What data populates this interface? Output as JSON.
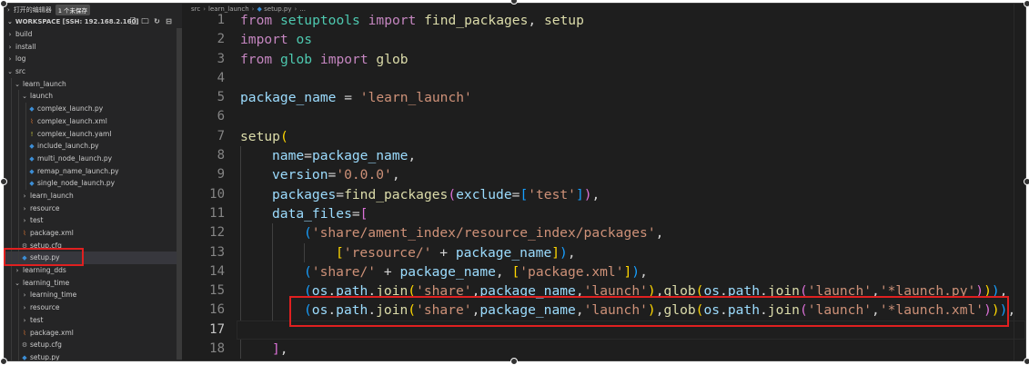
{
  "open_editors": {
    "title": "打开的编辑器",
    "badge": "1 个未保存"
  },
  "workspace": {
    "title": "WORKSPACE [SSH: 192.168.2.160]"
  },
  "tree": [
    {
      "label": "build",
      "type": "folder",
      "depth": 0,
      "open": false
    },
    {
      "label": "install",
      "type": "folder",
      "depth": 0,
      "open": false
    },
    {
      "label": "log",
      "type": "folder",
      "depth": 0,
      "open": false
    },
    {
      "label": "src",
      "type": "folder",
      "depth": 0,
      "open": true
    },
    {
      "label": "learn_launch",
      "type": "folder",
      "depth": 1,
      "open": true
    },
    {
      "label": "launch",
      "type": "folder",
      "depth": 2,
      "open": true
    },
    {
      "label": "complex_launch.py",
      "type": "py",
      "depth": 3
    },
    {
      "label": "complex_launch.xml",
      "type": "xml",
      "depth": 3
    },
    {
      "label": "complex_launch.yaml",
      "type": "yaml",
      "depth": 3
    },
    {
      "label": "include_launch.py",
      "type": "py",
      "depth": 3
    },
    {
      "label": "multi_node_launch.py",
      "type": "py",
      "depth": 3
    },
    {
      "label": "remap_name_launch.py",
      "type": "py",
      "depth": 3
    },
    {
      "label": "single_node_launch.py",
      "type": "py",
      "depth": 3
    },
    {
      "label": "learn_launch",
      "type": "folder",
      "depth": 2,
      "open": false
    },
    {
      "label": "resource",
      "type": "folder",
      "depth": 2,
      "open": false
    },
    {
      "label": "test",
      "type": "folder",
      "depth": 2,
      "open": false
    },
    {
      "label": "package.xml",
      "type": "xml",
      "depth": 2
    },
    {
      "label": "setup.cfg",
      "type": "cfg",
      "depth": 2
    },
    {
      "label": "setup.py",
      "type": "py",
      "depth": 2,
      "selected": true
    },
    {
      "label": "learning_dds",
      "type": "folder",
      "depth": 1,
      "open": false
    },
    {
      "label": "learning_time",
      "type": "folder",
      "depth": 1,
      "open": true
    },
    {
      "label": "learning_time",
      "type": "folder",
      "depth": 2,
      "open": false
    },
    {
      "label": "resource",
      "type": "folder",
      "depth": 2,
      "open": false
    },
    {
      "label": "test",
      "type": "folder",
      "depth": 2,
      "open": false
    },
    {
      "label": "package.xml",
      "type": "xml",
      "depth": 2
    },
    {
      "label": "setup.cfg",
      "type": "cfg",
      "depth": 2
    },
    {
      "label": "setup.py",
      "type": "py",
      "depth": 2
    }
  ],
  "breadcrumb": [
    "src",
    "learn_launch",
    "setup.py",
    "..."
  ],
  "code": [
    {
      "n": "1",
      "indent": 0,
      "tokens": [
        [
          "kw",
          "from"
        ],
        [
          "pl",
          " "
        ],
        [
          "mod",
          "setuptools"
        ],
        [
          "pl",
          " "
        ],
        [
          "kw",
          "import"
        ],
        [
          "pl",
          " "
        ],
        [
          "fn",
          "find_packages"
        ],
        [
          "pl",
          ", "
        ],
        [
          "fn",
          "setup"
        ]
      ]
    },
    {
      "n": "2",
      "indent": 0,
      "tokens": [
        [
          "kw",
          "import"
        ],
        [
          "pl",
          " "
        ],
        [
          "mod",
          "os"
        ]
      ]
    },
    {
      "n": "3",
      "indent": 0,
      "tokens": [
        [
          "kw",
          "from"
        ],
        [
          "pl",
          " "
        ],
        [
          "mod",
          "glob"
        ],
        [
          "pl",
          " "
        ],
        [
          "kw",
          "import"
        ],
        [
          "pl",
          " "
        ],
        [
          "fn",
          "glob"
        ]
      ]
    },
    {
      "n": "4",
      "indent": 0,
      "tokens": []
    },
    {
      "n": "5",
      "indent": 0,
      "tokens": [
        [
          "var",
          "package_name"
        ],
        [
          "pl",
          " = "
        ],
        [
          "str",
          "'learn_launch'"
        ]
      ]
    },
    {
      "n": "6",
      "indent": 0,
      "tokens": []
    },
    {
      "n": "7",
      "indent": 0,
      "tokens": [
        [
          "fn",
          "setup"
        ],
        [
          "b1",
          "("
        ]
      ]
    },
    {
      "n": "8",
      "indent": 1,
      "tokens": [
        [
          "var",
          "name"
        ],
        [
          "pl",
          "="
        ],
        [
          "var",
          "package_name"
        ],
        [
          "pl",
          ","
        ]
      ]
    },
    {
      "n": "9",
      "indent": 1,
      "tokens": [
        [
          "var",
          "version"
        ],
        [
          "pl",
          "="
        ],
        [
          "str",
          "'0.0.0'"
        ],
        [
          "pl",
          ","
        ]
      ]
    },
    {
      "n": "10",
      "indent": 1,
      "tokens": [
        [
          "var",
          "packages"
        ],
        [
          "pl",
          "="
        ],
        [
          "fn",
          "find_packages"
        ],
        [
          "b2",
          "("
        ],
        [
          "var",
          "exclude"
        ],
        [
          "pl",
          "="
        ],
        [
          "b3",
          "["
        ],
        [
          "str",
          "'test'"
        ],
        [
          "b3",
          "]"
        ],
        [
          "b2",
          ")"
        ],
        [
          "pl",
          ","
        ]
      ]
    },
    {
      "n": "11",
      "indent": 1,
      "tokens": [
        [
          "var",
          "data_files"
        ],
        [
          "pl",
          "="
        ],
        [
          "b2",
          "["
        ]
      ]
    },
    {
      "n": "12",
      "indent": 2,
      "tokens": [
        [
          "b3",
          "("
        ],
        [
          "str",
          "'share/ament_index/resource_index/packages'"
        ],
        [
          "pl",
          ","
        ]
      ]
    },
    {
      "n": "13",
      "indent": 3,
      "tokens": [
        [
          "b1",
          "["
        ],
        [
          "str",
          "'resource/'"
        ],
        [
          "pl",
          " + "
        ],
        [
          "var",
          "package_name"
        ],
        [
          "b1",
          "]"
        ],
        [
          "b3",
          ")"
        ],
        [
          "pl",
          ","
        ]
      ]
    },
    {
      "n": "14",
      "indent": 2,
      "tokens": [
        [
          "b3",
          "("
        ],
        [
          "str",
          "'share/'"
        ],
        [
          "pl",
          " + "
        ],
        [
          "var",
          "package_name"
        ],
        [
          "pl",
          ", "
        ],
        [
          "b1",
          "["
        ],
        [
          "str",
          "'package.xml'"
        ],
        [
          "b1",
          "]"
        ],
        [
          "b3",
          ")"
        ],
        [
          "pl",
          ","
        ]
      ]
    },
    {
      "n": "15",
      "indent": 2,
      "tokens": [
        [
          "b3",
          "("
        ],
        [
          "var",
          "os"
        ],
        [
          "pl",
          "."
        ],
        [
          "var",
          "path"
        ],
        [
          "pl",
          "."
        ],
        [
          "fn",
          "join"
        ],
        [
          "b1",
          "("
        ],
        [
          "str",
          "'share'"
        ],
        [
          "pl",
          ","
        ],
        [
          "var",
          "package_name"
        ],
        [
          "pl",
          ","
        ],
        [
          "str",
          "'launch'"
        ],
        [
          "b1",
          ")"
        ],
        [
          "pl",
          ","
        ],
        [
          "fn",
          "glob"
        ],
        [
          "b1",
          "("
        ],
        [
          "var",
          "os"
        ],
        [
          "pl",
          "."
        ],
        [
          "var",
          "path"
        ],
        [
          "pl",
          "."
        ],
        [
          "fn",
          "join"
        ],
        [
          "b2",
          "("
        ],
        [
          "str",
          "'launch'"
        ],
        [
          "pl",
          ","
        ],
        [
          "str",
          "'*launch.py'"
        ],
        [
          "b2",
          ")"
        ],
        [
          "b1",
          ")"
        ],
        [
          "b3",
          ")"
        ],
        [
          "pl",
          ","
        ]
      ]
    },
    {
      "n": "16",
      "indent": 2,
      "tokens": [
        [
          "b3",
          "("
        ],
        [
          "var",
          "os"
        ],
        [
          "pl",
          "."
        ],
        [
          "var",
          "path"
        ],
        [
          "pl",
          "."
        ],
        [
          "fn",
          "join"
        ],
        [
          "b1",
          "("
        ],
        [
          "str",
          "'share'"
        ],
        [
          "pl",
          ","
        ],
        [
          "var",
          "package_name"
        ],
        [
          "pl",
          ","
        ],
        [
          "str",
          "'launch'"
        ],
        [
          "b1",
          ")"
        ],
        [
          "pl",
          ","
        ],
        [
          "fn",
          "glob"
        ],
        [
          "b1",
          "("
        ],
        [
          "var",
          "os"
        ],
        [
          "pl",
          "."
        ],
        [
          "var",
          "path"
        ],
        [
          "pl",
          "."
        ],
        [
          "fn",
          "join"
        ],
        [
          "b2",
          "("
        ],
        [
          "str",
          "'launch'"
        ],
        [
          "pl",
          ","
        ],
        [
          "str",
          "'*launch.xml'"
        ],
        [
          "b2",
          ")"
        ],
        [
          "b1",
          ")"
        ],
        [
          "b3",
          ")"
        ],
        [
          "pl",
          ","
        ]
      ]
    },
    {
      "n": "17",
      "indent": 0,
      "tokens": [],
      "current": true
    },
    {
      "n": "18",
      "indent": 1,
      "tokens": [
        [
          "b2",
          "]"
        ],
        [
          "pl",
          ","
        ]
      ]
    }
  ]
}
